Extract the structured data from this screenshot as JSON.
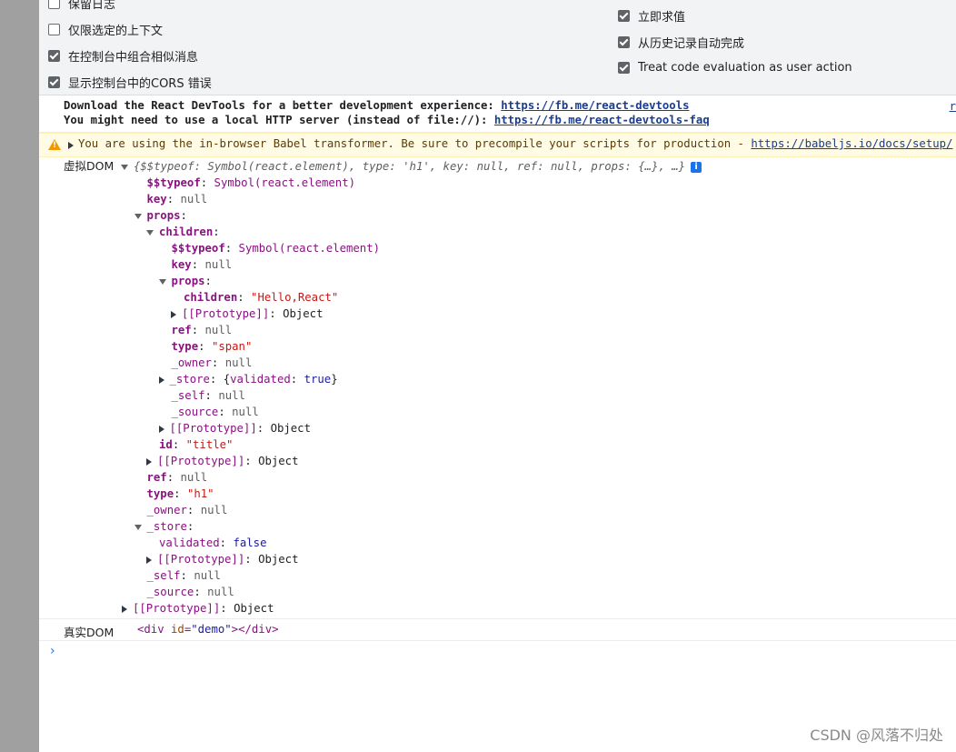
{
  "settings": {
    "left": [
      {
        "label": "保留日志",
        "checked": false
      },
      {
        "label": "仅限选定的上下文",
        "checked": false
      },
      {
        "label": "在控制台中组合相似消息",
        "checked": true
      },
      {
        "label": "显示控制台中的CORS 错误",
        "checked": true
      }
    ],
    "right": [
      {
        "label": "立即求值",
        "checked": true
      },
      {
        "label": "从历史记录自动完成",
        "checked": true
      },
      {
        "label": "Treat code evaluation as user action",
        "checked": true
      }
    ]
  },
  "info_message": {
    "line1_text": "Download the React DevTools for a better development experience: ",
    "line1_link": "https://fb.me/react-devtools",
    "line2_text": "You might need to use a local HTTP server (instead of file://): ",
    "line2_link": "https://fb.me/react-devtools-faq",
    "side_link": "r"
  },
  "warning_message": {
    "icon": "warning-icon",
    "text": "You are using the in-browser Babel transformer. Be sure to precompile your scripts for production - ",
    "link": "https://babeljs.io/docs/setup/"
  },
  "virtual_dom": {
    "label": "虚拟DOM",
    "summary": "{$$typeof: Symbol(react.element), type: 'h1', key: null, ref: null, props: {…}, …}",
    "badge": "i"
  },
  "tree_rows": [
    {
      "depth": 1,
      "toggle": "none",
      "key": "$$typeof",
      "sep": ": ",
      "value": "Symbol(react.element)",
      "vtype": "sym"
    },
    {
      "depth": 1,
      "toggle": "none",
      "key": "key",
      "sep": ": ",
      "value": "null",
      "vtype": "nul"
    },
    {
      "depth": 1,
      "toggle": "down",
      "key": "props",
      "sep": ":",
      "value": "",
      "vtype": "obj"
    },
    {
      "depth": 2,
      "toggle": "down",
      "key": "children",
      "sep": ":",
      "value": "",
      "vtype": "obj"
    },
    {
      "depth": 3,
      "toggle": "none",
      "key": "$$typeof",
      "sep": ": ",
      "value": "Symbol(react.element)",
      "vtype": "sym"
    },
    {
      "depth": 3,
      "toggle": "none",
      "key": "key",
      "sep": ": ",
      "value": "null",
      "vtype": "nul"
    },
    {
      "depth": 3,
      "toggle": "down",
      "key": "props",
      "sep": ":",
      "value": "",
      "vtype": "obj"
    },
    {
      "depth": 4,
      "toggle": "none",
      "key": "children",
      "sep": ": ",
      "value": "\"Hello,React\"",
      "vtype": "str"
    },
    {
      "depth": 4,
      "toggle": "right",
      "key": "[[Prototype]]",
      "sep": ": ",
      "value": "Object",
      "vtype": "obj",
      "keyPlain": true
    },
    {
      "depth": 3,
      "toggle": "none",
      "key": "ref",
      "sep": ": ",
      "value": "null",
      "vtype": "nul"
    },
    {
      "depth": 3,
      "toggle": "none",
      "key": "type",
      "sep": ": ",
      "value": "\"span\"",
      "vtype": "str"
    },
    {
      "depth": 3,
      "toggle": "none",
      "key": "_owner",
      "sep": ": ",
      "value": "null",
      "vtype": "nul",
      "keyPlain": true
    },
    {
      "depth": 3,
      "toggle": "right",
      "key": "_store",
      "sep": ": ",
      "value": "{validated: true}",
      "vtype": "objstore",
      "keyPlain": true
    },
    {
      "depth": 3,
      "toggle": "none",
      "key": "_self",
      "sep": ": ",
      "value": "null",
      "vtype": "nul",
      "keyPlain": true
    },
    {
      "depth": 3,
      "toggle": "none",
      "key": "_source",
      "sep": ": ",
      "value": "null",
      "vtype": "nul",
      "keyPlain": true
    },
    {
      "depth": 3,
      "toggle": "right",
      "key": "[[Prototype]]",
      "sep": ": ",
      "value": "Object",
      "vtype": "obj",
      "keyPlain": true
    },
    {
      "depth": 2,
      "toggle": "none",
      "key": "id",
      "sep": ": ",
      "value": "\"title\"",
      "vtype": "str"
    },
    {
      "depth": 2,
      "toggle": "right",
      "key": "[[Prototype]]",
      "sep": ": ",
      "value": "Object",
      "vtype": "obj",
      "keyPlain": true
    },
    {
      "depth": 1,
      "toggle": "none",
      "key": "ref",
      "sep": ": ",
      "value": "null",
      "vtype": "nul"
    },
    {
      "depth": 1,
      "toggle": "none",
      "key": "type",
      "sep": ": ",
      "value": "\"h1\"",
      "vtype": "str"
    },
    {
      "depth": 1,
      "toggle": "none",
      "key": "_owner",
      "sep": ": ",
      "value": "null",
      "vtype": "nul",
      "keyPlain": true
    },
    {
      "depth": 1,
      "toggle": "down",
      "key": "_store",
      "sep": ":",
      "value": "",
      "vtype": "obj",
      "keyPlain": true
    },
    {
      "depth": 2,
      "toggle": "none",
      "key": "validated",
      "sep": ": ",
      "value": "false",
      "vtype": "bool",
      "keyPlain": true
    },
    {
      "depth": 2,
      "toggle": "right",
      "key": "[[Prototype]]",
      "sep": ": ",
      "value": "Object",
      "vtype": "obj",
      "keyPlain": true
    },
    {
      "depth": 1,
      "toggle": "none",
      "key": "_self",
      "sep": ": ",
      "value": "null",
      "vtype": "nul",
      "keyPlain": true
    },
    {
      "depth": 1,
      "toggle": "none",
      "key": "_source",
      "sep": ": ",
      "value": "null",
      "vtype": "nul",
      "keyPlain": true
    },
    {
      "depth": 0,
      "toggle": "right",
      "key": "[[Prototype]]",
      "sep": ": ",
      "value": "Object",
      "vtype": "obj",
      "keyPlain": true
    }
  ],
  "real_dom": {
    "label": "真实DOM",
    "tag_open": "<div",
    "attr_name": "id",
    "attr_eq": "=",
    "attr_value": "\"demo\"",
    "tag_close": "></div>"
  },
  "prompt_symbol": "›",
  "watermark": "CSDN @风落不归处"
}
